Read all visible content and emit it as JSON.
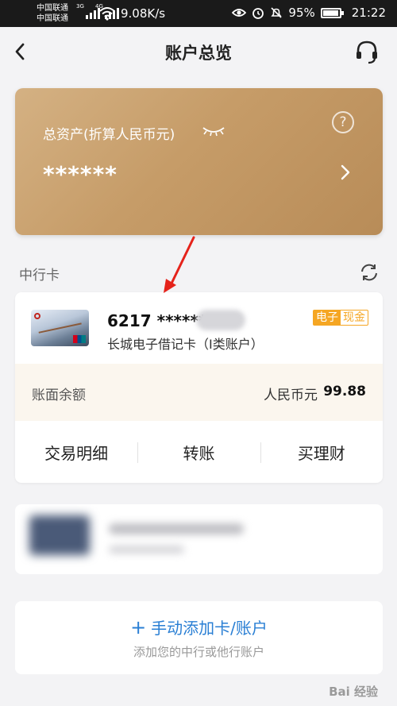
{
  "status_bar": {
    "carrier_1": "中国联通",
    "carrier_2": "中国联通",
    "net_tag_1": "3G",
    "net_tag_2": "4G",
    "speed": "9.08K/s",
    "battery": "95%",
    "time": "21:22"
  },
  "nav": {
    "title": "账户总览",
    "back_icon": "back-chevron-icon",
    "service_icon": "headset-icon"
  },
  "asset_card": {
    "label": "总资产(折算人民币元)",
    "masked_total": "******",
    "help_glyph": "?"
  },
  "section": {
    "label": "中行卡"
  },
  "card": {
    "number": "6217 ******",
    "name": "长城电子借记卡（I类账户）",
    "tag_a": "电子",
    "tag_b": "现金",
    "balance_label": "账面余额",
    "currency": "人民币元",
    "balance": "99.88"
  },
  "actions": [
    {
      "label": "交易明细"
    },
    {
      "label": "转账"
    },
    {
      "label": "买理财"
    }
  ],
  "add_account": {
    "plus": "+",
    "title": "手动添加卡/账户",
    "subtitle": "添加您的中行或他行账户"
  },
  "watermark": "Bai 经验",
  "colors": {
    "gold_card": "#c69c68",
    "accent_blue": "#2a7fd4",
    "tag_orange": "#f5a623",
    "balance_bg": "#fbf6ee"
  }
}
